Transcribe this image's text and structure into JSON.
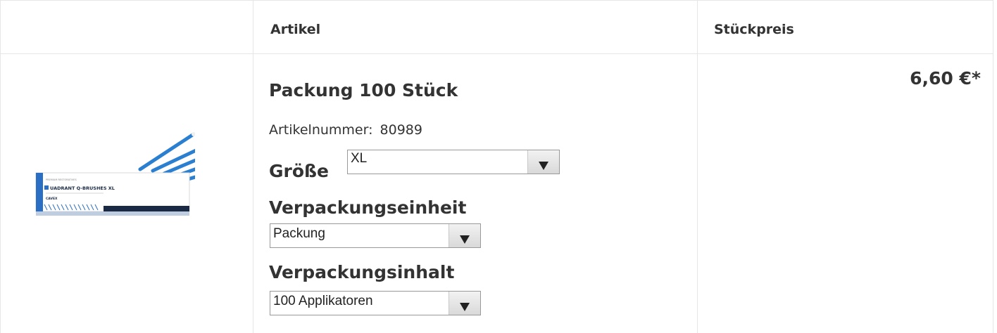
{
  "table": {
    "headers": {
      "artikel": "Artikel",
      "stueckpreis": "Stückpreis"
    }
  },
  "product": {
    "image_text": {
      "kicker": "PREMIUM RESTORATIVES",
      "name": "UADRANT Q-BRUSHES XL",
      "brand": "CAVEX"
    },
    "title": "Packung 100 Stück",
    "artikelnummer_label": "Artikelnummer:",
    "artikelnummer": "80989",
    "size_label": "Größe",
    "size_value": "XL",
    "vpe_label": "Verpackungseinheit",
    "vpe_value": "Packung",
    "vpi_label": "Verpackungsinhalt",
    "vpi_value": "100 Applikatoren",
    "price": "6,60 €*"
  },
  "colors": {
    "border": "#e6e6e6",
    "text": "#333333",
    "box_blue": "#2a6fc4",
    "brush_blue": "#2a7fd0"
  },
  "icons": {
    "dropdown": "chevron-down-icon"
  }
}
